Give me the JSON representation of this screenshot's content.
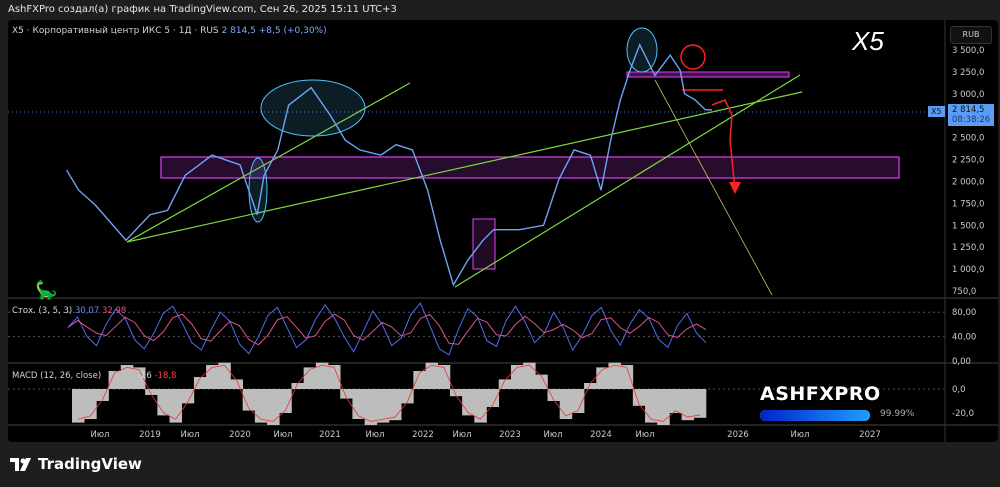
{
  "header": {
    "attribution": "AshFXPro создал(а) график на TradingView.com, Сен 26, 2025 15:11 UTC+3"
  },
  "legend": {
    "symbol": "X5 · Корпоративный центр ИКС 5 · 1Д · RUS",
    "price": "2 814,5",
    "change": "+8,5 (+0,30%)"
  },
  "watermark_label": "X5",
  "currency": "RUB",
  "price_tag": {
    "symbol": "X5",
    "price": "2 814,5",
    "countdown": "08:38:26"
  },
  "stoch": {
    "label": "Стох. (3, 5, 3)",
    "k": "30,07",
    "d": "32,98"
  },
  "macd": {
    "label": "MACD (12, 26, close)",
    "v1": "-26",
    "v2": "-18,8"
  },
  "brand": {
    "name": "ASHFXPRO",
    "progress_label": "99.99%",
    "progress": 99.99
  },
  "footer": {
    "logo": "TradingView"
  },
  "colors": {
    "price": "#6fa3f5",
    "stoch_k": "#4f6cf0",
    "stoch_d": "#e0508a",
    "macd_hist": "#bdbdbd",
    "macd_line": "#e53935",
    "trend": "#7ddb3a",
    "zone": "#e040fb",
    "ellipse": "#4fc3f7",
    "arrow": "#ff2020"
  },
  "chart_data": {
    "type": "line",
    "title": "X5 · Корпоративный центр ИКС 5 · 1Д · RUS",
    "xlabel": "",
    "ylabel": "RUB",
    "ylim": [
      750,
      3500
    ],
    "yticks": [
      "3 500,0",
      "3 250,0",
      "3 000,0",
      "2 750,0",
      "2 500,0",
      "2 250,0",
      "2 000,0",
      "1 750,0",
      "1 500,0",
      "1 250,0",
      "1 000,0",
      "750,0"
    ],
    "ytick_values": [
      3500,
      3250,
      3000,
      2750,
      2500,
      2250,
      2000,
      1750,
      1500,
      1250,
      1000,
      750
    ],
    "xticks": [
      {
        "label": "Июл",
        "t": 2018.5
      },
      {
        "label": "2019",
        "t": 2019
      },
      {
        "label": "Июл",
        "t": 2019.5
      },
      {
        "label": "2020",
        "t": 2020
      },
      {
        "label": "Июл",
        "t": 2020.5
      },
      {
        "label": "2021",
        "t": 2021
      },
      {
        "label": "Июл",
        "t": 2021.5
      },
      {
        "label": "2022",
        "t": 2022
      },
      {
        "label": "Июл",
        "t": 2022.5
      },
      {
        "label": "2023",
        "t": 2023
      },
      {
        "label": "Июл",
        "t": 2023.5
      },
      {
        "label": "2024",
        "t": 2024
      },
      {
        "label": "Июл",
        "t": 2024.5
      },
      {
        "label": "2026",
        "t": 2026
      },
      {
        "label": "Июл",
        "t": 2026.5
      },
      {
        "label": "2027",
        "t": 2027
      }
    ],
    "series": [
      {
        "name": "X5 close",
        "t": [
          2018.06,
          2018.22,
          2018.44,
          2018.76,
          2019.0,
          2019.22,
          2019.44,
          2019.72,
          2020.0,
          2020.2,
          2020.28,
          2020.44,
          2020.56,
          2020.8,
          2021.0,
          2021.17,
          2021.33,
          2021.56,
          2021.72,
          2021.89,
          2022.06,
          2022.22,
          2022.39,
          2022.56,
          2022.72,
          2022.83,
          2023.11,
          2023.39,
          2023.56,
          2023.72,
          2023.89,
          2024.0,
          2024.11,
          2024.22,
          2024.33,
          2024.44,
          2024.61,
          2024.78,
          2024.89,
          2024.94,
          2025.17,
          2025.5,
          2025.73
        ],
        "values": [
          2130,
          1900,
          1730,
          1330,
          1620,
          1670,
          2070,
          2300,
          2190,
          1620,
          2070,
          2360,
          2870,
          3070,
          2760,
          2470,
          2360,
          2300,
          2420,
          2360,
          1900,
          1330,
          820,
          1100,
          1330,
          1450,
          1450,
          1500,
          2020,
          2360,
          2300,
          1900,
          2470,
          2930,
          3270,
          3560,
          3210,
          3440,
          3270,
          3000,
          2930,
          2820,
          2814.5
        ]
      }
    ],
    "stoch": {
      "ylim": [
        0,
        100
      ],
      "yticks": [
        "80,00",
        "40,00",
        "0,00"
      ],
      "ytick_values": [
        80,
        40,
        0
      ],
      "k": [
        55,
        72,
        40,
        25,
        60,
        85,
        70,
        35,
        20,
        45,
        78,
        90,
        62,
        30,
        18,
        50,
        80,
        65,
        28,
        12,
        40,
        75,
        88,
        55,
        22,
        35,
        68,
        92,
        70,
        40,
        15,
        48,
        82,
        60,
        25,
        38,
        76,
        95,
        58,
        20,
        10,
        52,
        86,
        72,
        33,
        24,
        66,
        90,
        64,
        30,
        45,
        80,
        55,
        18,
        42,
        74,
        88,
        50,
        26,
        60,
        84,
        70,
        36,
        22,
        58,
        78,
        46,
        30
      ],
      "last_k": 30.07,
      "last_d": 32.98
    },
    "macd": {
      "ylim": [
        -30,
        22
      ],
      "yticks": [
        "0,0",
        "-20,0"
      ],
      "ytick_values": [
        0,
        -20
      ],
      "hist": [
        -28,
        -25,
        -10,
        15,
        20,
        18,
        -5,
        -22,
        -28,
        -12,
        10,
        20,
        22,
        8,
        -18,
        -28,
        -30,
        -20,
        5,
        18,
        22,
        20,
        -8,
        -25,
        -30,
        -28,
        -26,
        -12,
        15,
        22,
        20,
        -6,
        -22,
        -28,
        -15,
        8,
        20,
        22,
        12,
        -10,
        -25,
        -20,
        5,
        18,
        22,
        20,
        -14,
        -28,
        -30,
        -20,
        -26,
        -24
      ]
    }
  }
}
